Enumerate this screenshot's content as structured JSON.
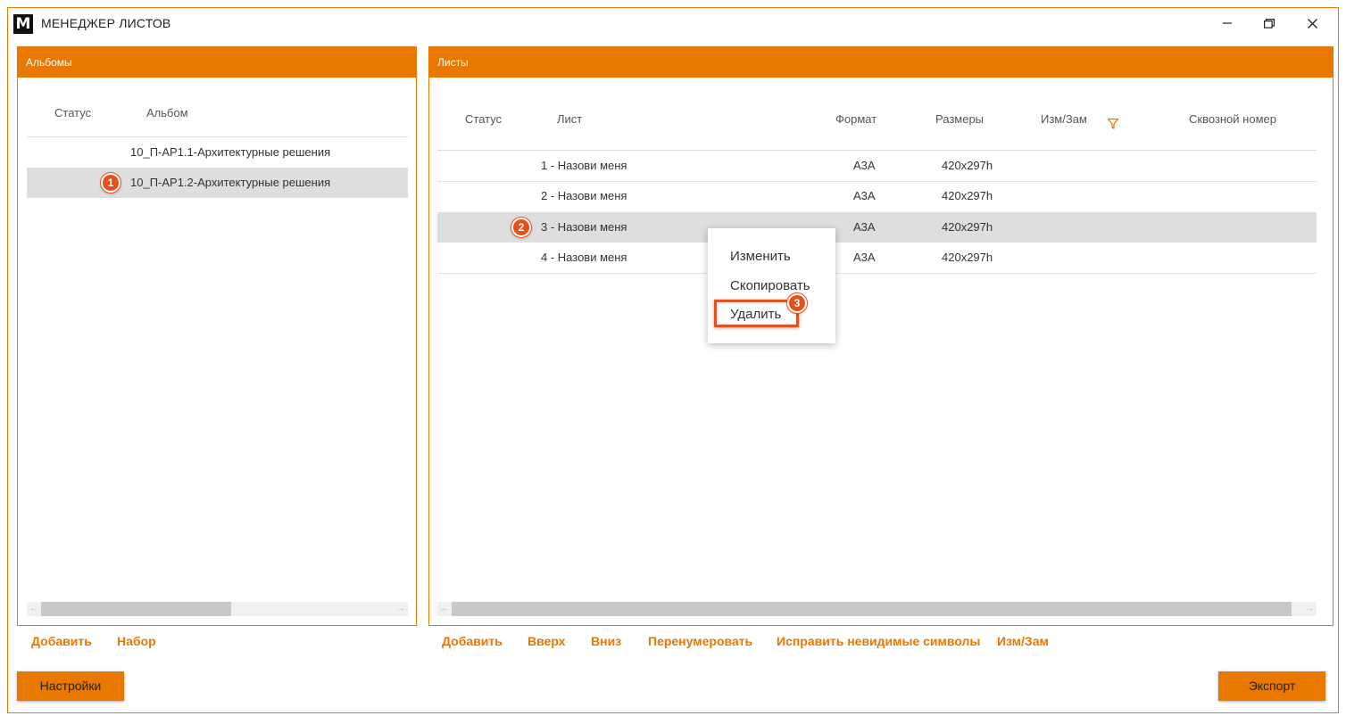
{
  "window": {
    "logo_letter": "M",
    "title": "МЕНЕДЖЕР ЛИСТОВ"
  },
  "albums_panel": {
    "title": "Альбомы",
    "columns": [
      "Статус",
      "Альбом"
    ],
    "rows": [
      {
        "status": "",
        "album": "10_П-АР1.1-Архитектурные решения",
        "selected": false
      },
      {
        "status": "",
        "album": "10_П-АР1.2-Архитектурные решения",
        "selected": true,
        "marker": "1"
      }
    ],
    "actions": [
      "Добавить",
      "Набор"
    ]
  },
  "sheets_panel": {
    "title": "Листы",
    "columns": [
      "Статус",
      "Лист",
      "Формат",
      "Размеры",
      "Изм/Зам",
      "Сквозной номер"
    ],
    "rows": [
      {
        "status": "",
        "sheet": "1 - Назови меня",
        "format": "А3А",
        "size": "420x297h",
        "selected": false
      },
      {
        "status": "",
        "sheet": "2 - Назови меня",
        "format": "А3А",
        "size": "420x297h",
        "selected": false
      },
      {
        "status": "",
        "sheet": "3 - Назови меня",
        "format": "А3А",
        "size": "420x297h",
        "selected": true,
        "marker": "2"
      },
      {
        "status": "",
        "sheet": "4 - Назови меня",
        "format": "А3А",
        "size": "420x297h",
        "selected": false
      }
    ],
    "actions": [
      "Добавить",
      "Вверх",
      "Вниз",
      "Перенумеровать",
      "Исправить невидимые символы",
      "Изм/Зам"
    ]
  },
  "context_menu": {
    "items": [
      "Изменить",
      "Скопировать",
      "Удалить"
    ],
    "highlighted_item": "Удалить",
    "marker": "3"
  },
  "footer": {
    "settings_label": "Настройки",
    "export_label": "Экспорт"
  },
  "colors": {
    "accent": "#e87800",
    "marker": "#e8501a",
    "selected_row": "#dedede"
  },
  "icons": [
    "minimize-icon",
    "maximize-icon",
    "close-icon",
    "filter-icon",
    "scroll-left-icon",
    "scroll-right-icon"
  ]
}
